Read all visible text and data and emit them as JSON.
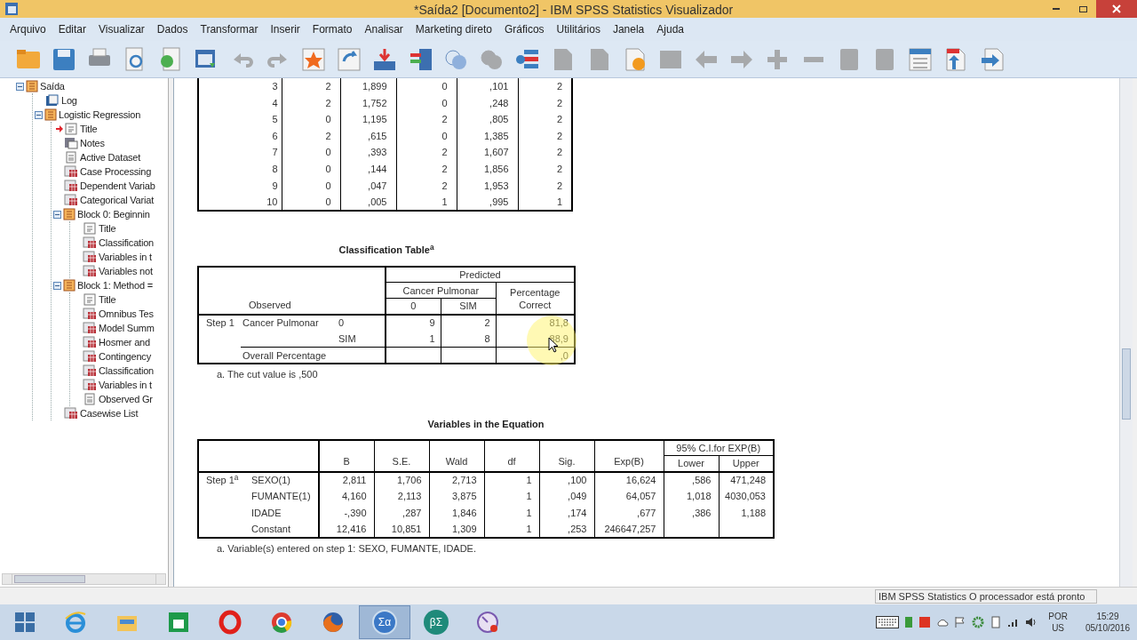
{
  "window": {
    "title": "*Saída2 [Documento2] - IBM SPSS Statistics Visualizador"
  },
  "menu": [
    "Arquivo",
    "Editar",
    "Visualizar",
    "Dados",
    "Transformar",
    "Inserir",
    "Formato",
    "Analisar",
    "Marketing direto",
    "Gráficos",
    "Utilitários",
    "Janela",
    "Ajuda"
  ],
  "toolbar": [
    {
      "kind": "folder",
      "disabled": false
    },
    {
      "kind": "disk",
      "disabled": false
    },
    {
      "kind": "printer",
      "disabled": false
    },
    {
      "kind": "preview",
      "disabled": false
    },
    {
      "kind": "export",
      "disabled": false
    },
    {
      "kind": "window",
      "disabled": false
    },
    {
      "kind": "undo",
      "disabled": true
    },
    {
      "kind": "redo",
      "disabled": true
    },
    {
      "kind": "star",
      "disabled": false
    },
    {
      "kind": "table",
      "disabled": false
    },
    {
      "kind": "download",
      "disabled": false
    },
    {
      "kind": "grid",
      "disabled": false
    },
    {
      "kind": "circles",
      "disabled": false
    },
    {
      "kind": "circles",
      "disabled": true
    },
    {
      "kind": "list",
      "disabled": false
    },
    {
      "kind": "doc",
      "disabled": true
    },
    {
      "kind": "doc",
      "disabled": true
    },
    {
      "kind": "doc-play",
      "disabled": false
    },
    {
      "kind": "square",
      "disabled": true
    },
    {
      "kind": "arrow-left",
      "disabled": true
    },
    {
      "kind": "arrow-right",
      "disabled": true
    },
    {
      "kind": "plus",
      "disabled": true
    },
    {
      "kind": "minus",
      "disabled": true
    },
    {
      "kind": "book",
      "disabled": true
    },
    {
      "kind": "book",
      "disabled": true
    },
    {
      "kind": "lines",
      "disabled": false
    },
    {
      "kind": "doc-up",
      "disabled": false
    },
    {
      "kind": "doc-right",
      "disabled": false
    }
  ],
  "tree": [
    {
      "label": "Saída",
      "kind": "book",
      "expanded": true,
      "selected": false,
      "children": [
        {
          "label": "Log",
          "kind": "log",
          "selected": false
        },
        {
          "label": "Logistic Regression",
          "kind": "book",
          "expanded": true,
          "selected": false,
          "children": [
            {
              "label": "Title",
              "kind": "title",
              "selected": true
            },
            {
              "label": "Notes",
              "kind": "notes",
              "selected": false
            },
            {
              "label": "Active Dataset",
              "kind": "text",
              "selected": false
            },
            {
              "label": "Case Processing",
              "kind": "table",
              "selected": false
            },
            {
              "label": "Dependent Variab",
              "kind": "table",
              "selected": false
            },
            {
              "label": "Categorical Variat",
              "kind": "table",
              "selected": false
            },
            {
              "label": "Block 0: Beginnin",
              "kind": "book",
              "expanded": true,
              "selected": false,
              "children": [
                {
                  "label": "Title",
                  "kind": "title",
                  "selected": false
                },
                {
                  "label": "Classification",
                  "kind": "table",
                  "selected": false
                },
                {
                  "label": "Variables in t",
                  "kind": "table",
                  "selected": false
                },
                {
                  "label": "Variables not",
                  "kind": "table",
                  "selected": false
                }
              ]
            },
            {
              "label": "Block 1: Method =",
              "kind": "book",
              "expanded": true,
              "selected": false,
              "children": [
                {
                  "label": "Title",
                  "kind": "title",
                  "selected": false
                },
                {
                  "label": "Omnibus Tes",
                  "kind": "table",
                  "selected": false
                },
                {
                  "label": "Model Summ",
                  "kind": "table",
                  "selected": false
                },
                {
                  "label": "Hosmer and",
                  "kind": "table",
                  "selected": false
                },
                {
                  "label": "Contingency",
                  "kind": "table",
                  "selected": false
                },
                {
                  "label": "Classification",
                  "kind": "table",
                  "selected": false
                },
                {
                  "label": "Variables in t",
                  "kind": "table",
                  "selected": false
                },
                {
                  "label": "Observed Gr",
                  "kind": "text",
                  "selected": false
                }
              ]
            },
            {
              "label": "Casewise List",
              "kind": "table",
              "selected": false
            }
          ]
        }
      ]
    }
  ],
  "casewise_table": {
    "rows": [
      [
        "3",
        "2",
        "1,899",
        "0",
        ",101",
        "2"
      ],
      [
        "4",
        "2",
        "1,752",
        "0",
        ",248",
        "2"
      ],
      [
        "5",
        "0",
        "1,195",
        "2",
        ",805",
        "2"
      ],
      [
        "6",
        "2",
        ",615",
        "0",
        "1,385",
        "2"
      ],
      [
        "7",
        "0",
        ",393",
        "2",
        "1,607",
        "2"
      ],
      [
        "8",
        "0",
        ",144",
        "2",
        "1,856",
        "2"
      ],
      [
        "9",
        "0",
        ",047",
        "2",
        "1,953",
        "2"
      ],
      [
        "10",
        "0",
        ",005",
        "1",
        ",995",
        "1"
      ]
    ]
  },
  "classification_table": {
    "title": "Classification Table$^{a}$",
    "predicted": "Predicted",
    "group": "Cancer Pulmonar",
    "categories": [
      "0",
      "SIM"
    ],
    "percentage": "Percentage Correct",
    "observed": "Observed",
    "step": "Step 1",
    "variable": "Cancer Pulmonar",
    "rows": [
      {
        "value": "0",
        "cells": [
          "9",
          "2",
          "81,8"
        ]
      },
      {
        "value": "SIM",
        "cells": [
          "1",
          "8",
          "88,9"
        ]
      }
    ],
    "overall": {
      "label": "Overall Percentage",
      "percentage": ",0"
    },
    "footnote": "a. The cut value is ,500"
  },
  "variables_table": {
    "title": "Variables in the Equation",
    "columns": [
      "B",
      "S.E.",
      "Wald",
      "df",
      "Sig.",
      "Exp(B)"
    ],
    "ci_header": "95% C.I.for EXP(B)",
    "ci_columns": [
      "Lower",
      "Upper"
    ],
    "step": "Step 1$^{a}$",
    "rows": [
      {
        "name": "SEXO(1)",
        "values": [
          "2,811",
          "1,706",
          "2,713",
          "1",
          ",100",
          "16,624",
          ",586",
          "471,248"
        ]
      },
      {
        "name": "FUMANTE(1)",
        "values": [
          "4,160",
          "2,113",
          "3,875",
          "1",
          ",049",
          "64,057",
          "1,018",
          "4030,053"
        ]
      },
      {
        "name": "IDADE",
        "values": [
          "-,390",
          ",287",
          "1,846",
          "1",
          ",174",
          ",677",
          ",386",
          "1,188"
        ]
      },
      {
        "name": "Constant",
        "values": [
          "12,416",
          "10,851",
          "1,309",
          "1",
          ",253",
          "246647,257"
        ]
      }
    ],
    "footnote": "a. Variable(s) entered on step 1: SEXO, FUMANTE, IDADE."
  },
  "status_bar": {
    "text": "IBM SPSS Statistics O processador está pronto"
  },
  "taskbar": {
    "apps": [
      {
        "kind": "ie",
        "active": false
      },
      {
        "kind": "explorer",
        "active": false
      },
      {
        "kind": "store",
        "active": false
      },
      {
        "kind": "opera",
        "active": false
      },
      {
        "kind": "chrome",
        "active": false
      },
      {
        "kind": "firefox",
        "active": false
      },
      {
        "kind": "spss",
        "label": "Σα",
        "active": true
      },
      {
        "kind": "beta",
        "label": "βΣ",
        "active": false
      },
      {
        "kind": "gauge",
        "active": false
      }
    ],
    "language": "POR",
    "layout": "US",
    "time": "15:29",
    "date": "05/10/2016"
  }
}
